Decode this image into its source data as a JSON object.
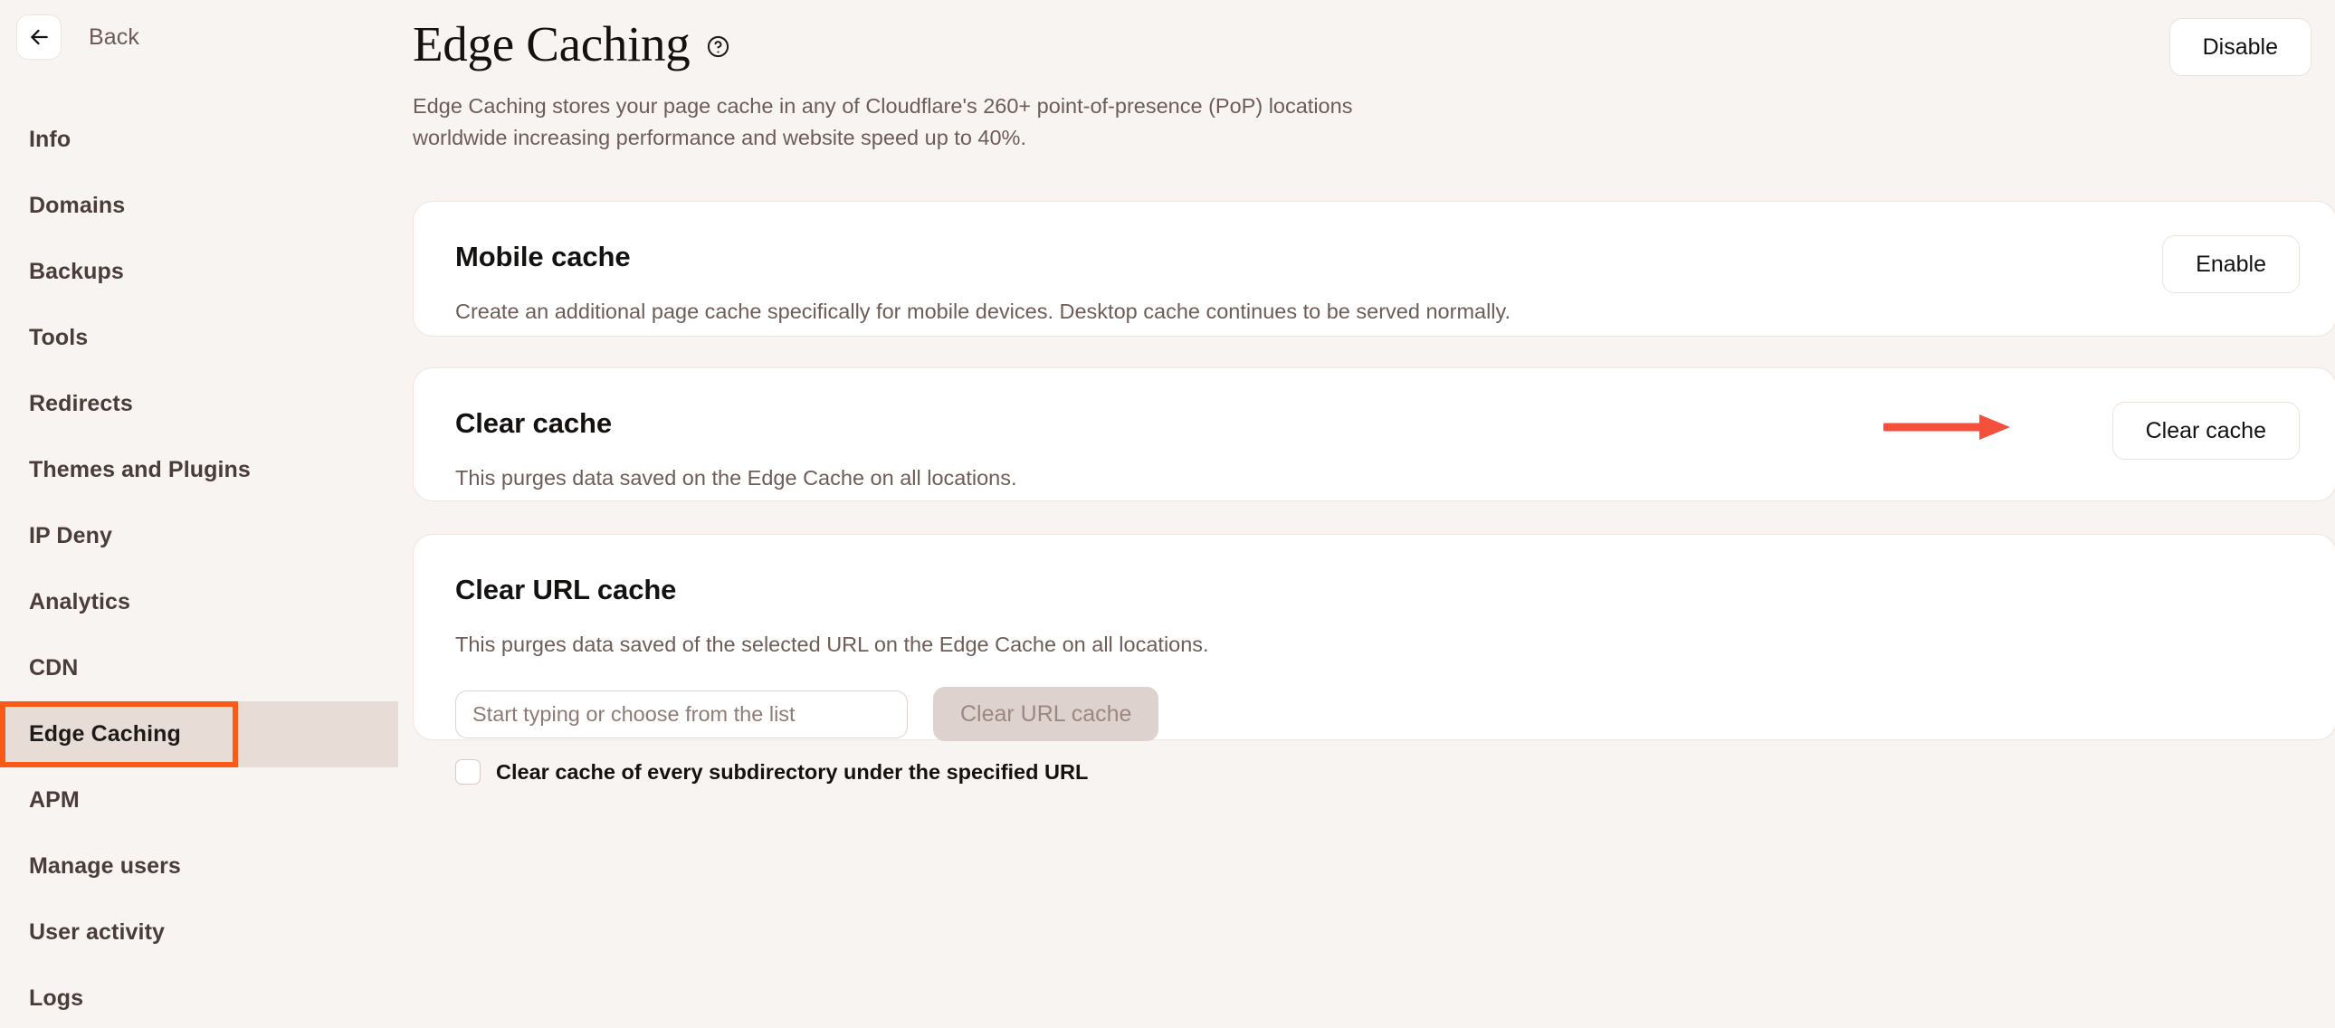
{
  "sidebar": {
    "back_label": "Back",
    "back_icon": "arrow-left-icon",
    "items": [
      {
        "label": "Info",
        "active": false
      },
      {
        "label": "Domains",
        "active": false
      },
      {
        "label": "Backups",
        "active": false
      },
      {
        "label": "Tools",
        "active": false
      },
      {
        "label": "Redirects",
        "active": false
      },
      {
        "label": "Themes and Plugins",
        "active": false
      },
      {
        "label": "IP Deny",
        "active": false
      },
      {
        "label": "Analytics",
        "active": false
      },
      {
        "label": "CDN",
        "active": false
      },
      {
        "label": "Edge Caching",
        "active": true
      },
      {
        "label": "APM",
        "active": false
      },
      {
        "label": "Manage users",
        "active": false
      },
      {
        "label": "User activity",
        "active": false
      },
      {
        "label": "Logs",
        "active": false
      }
    ]
  },
  "header": {
    "title": "Edge Caching",
    "help_icon": "question-circle-icon",
    "description": "Edge Caching stores your page cache in any of Cloudflare's 260+ point-of-presence (PoP) locations worldwide increasing performance and website speed up to 40%.",
    "disable_label": "Disable"
  },
  "cards": {
    "mobile_cache": {
      "title": "Mobile cache",
      "text": "Create an additional page cache specifically for mobile devices. Desktop cache continues to be served normally.",
      "action_label": "Enable"
    },
    "clear_cache": {
      "title": "Clear cache",
      "text": "This purges data saved on the Edge Cache on all locations.",
      "action_label": "Clear cache"
    },
    "clear_url_cache": {
      "title": "Clear URL cache",
      "text": "This purges data saved of the selected URL on the Edge Cache on all locations.",
      "input_placeholder": "Start typing or choose from the list",
      "input_value": "",
      "action_label": "Clear URL cache",
      "checkbox_label": "Clear cache of every subdirectory under the specified URL",
      "checkbox_checked": false
    }
  },
  "annotations": {
    "arrow_color": "#F5503C",
    "highlight_color": "#FA5A16",
    "arrow_target": "Clear cache",
    "highlight_target": "Edge Caching"
  }
}
